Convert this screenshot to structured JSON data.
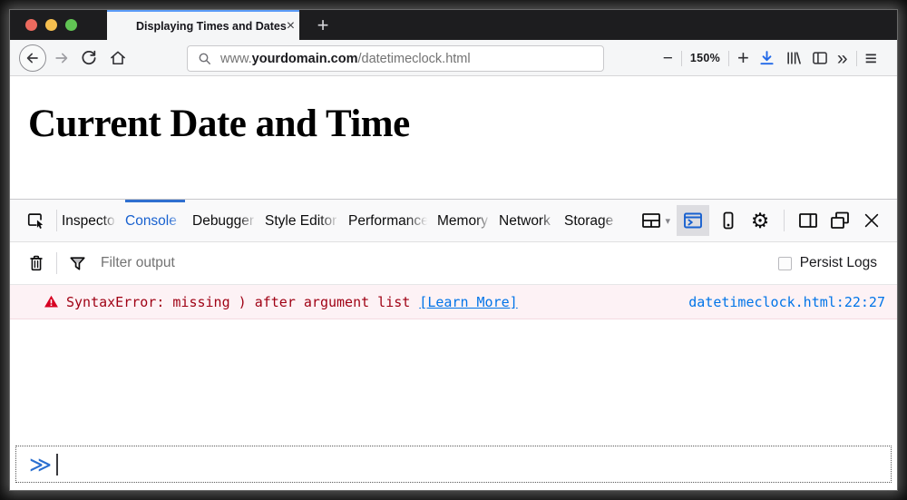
{
  "window": {
    "tab_title": "Displaying Times and Dates",
    "close_tab_glyph": "×",
    "new_tab_glyph": "+"
  },
  "toolbar": {
    "url_prefix": "www.",
    "url_domain": "yourdomain.com",
    "url_path": "/datetimeclock.html",
    "zoom_out_glyph": "−",
    "zoom_level": "150%",
    "zoom_in_glyph": "+",
    "overflow_glyph": "»",
    "menu_glyph": "≡"
  },
  "page": {
    "heading": "Current Date and Time"
  },
  "devtools": {
    "tabs": [
      {
        "label": "Inspector",
        "active": false
      },
      {
        "label": "Console",
        "active": true
      },
      {
        "label": "Debugger",
        "active": false
      },
      {
        "label": "Style Editor",
        "active": false
      },
      {
        "label": "Performance",
        "active": false
      },
      {
        "label": "Memory",
        "active": false
      },
      {
        "label": "Network",
        "active": false
      },
      {
        "label": "Storage",
        "active": false
      }
    ],
    "caret_glyph": "▾",
    "gear_glyph": "⚙",
    "close_glyph": "×",
    "filter_placeholder": "Filter output",
    "persist_logs_label": "Persist Logs",
    "console": {
      "error_message": "SyntaxError: missing ) after argument list",
      "learn_more_label": "[Learn More]",
      "source_location": "datetimeclock.html:22:27",
      "prompt_glyph": "≫"
    }
  },
  "colors": {
    "accent_blue": "#2f6fd0",
    "error_text": "#9f0013",
    "error_background": "#fdf2f5",
    "link_blue": "#0074e8",
    "download_blue": "#2168e8",
    "titlebar_dark": "#1d1d1f"
  }
}
